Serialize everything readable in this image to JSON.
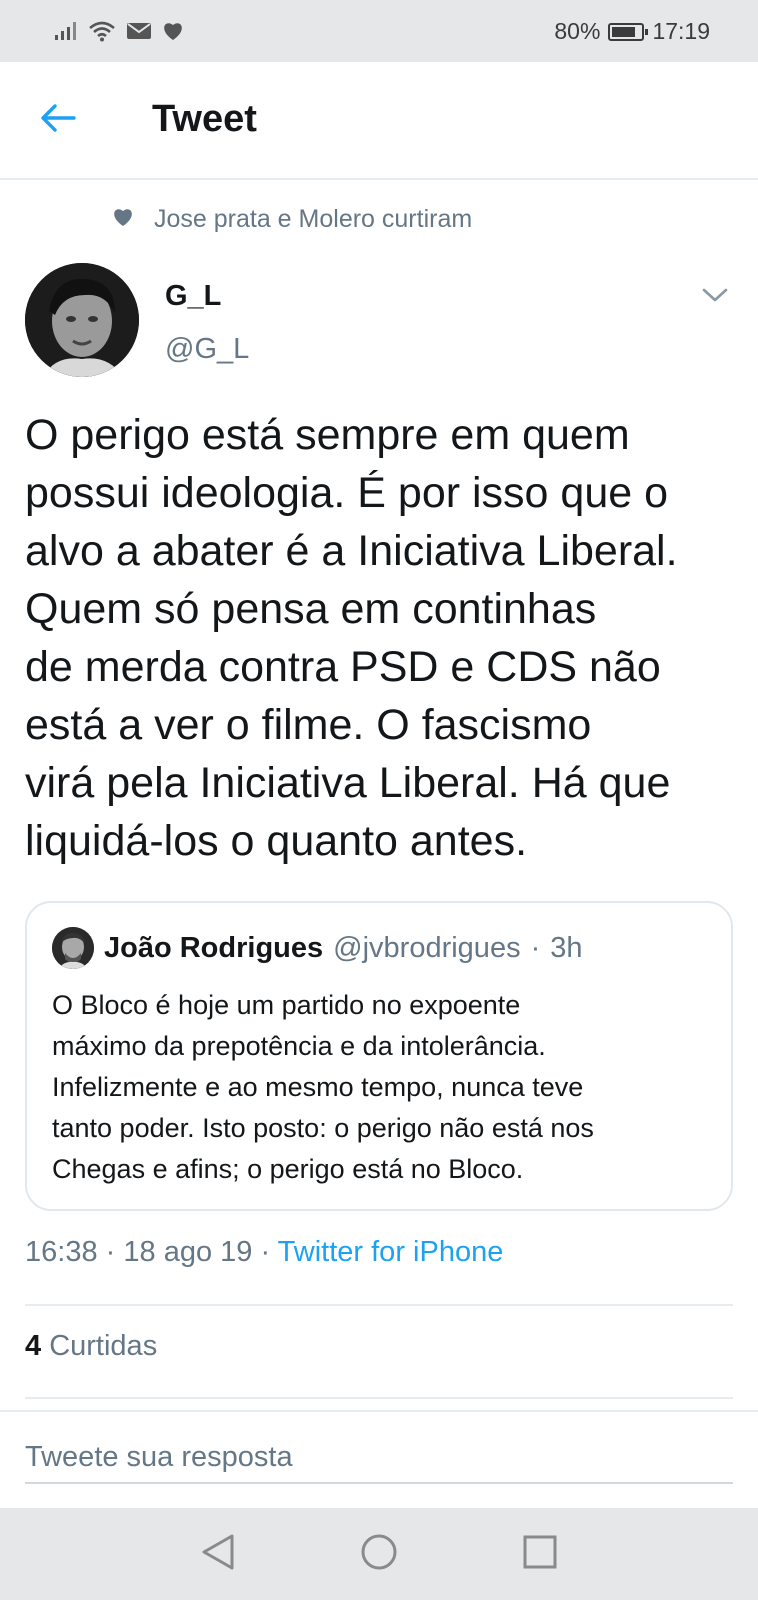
{
  "status_bar": {
    "battery_text": "80%",
    "battery_level": 0.8,
    "time": "17:19"
  },
  "header": {
    "title": "Tweet"
  },
  "social_context": {
    "text": "Jose prata e Molero curtiram"
  },
  "author": {
    "display_name": "G_L",
    "username": "@G_L"
  },
  "tweet": {
    "text": "O perigo está sempre em quem\npossui ideologia. É por isso que o\nalvo a abater é a Iniciativa Liberal.\nQuem só pensa em continhas\nde merda contra PSD e CDS não\nestá a ver o filme. O fascismo\nvirá pela Iniciativa Liberal. Há que\nliquidá-los o quanto antes.",
    "time": "16:38",
    "date": "18 ago 19",
    "separator": "·",
    "source": "Twitter for iPhone"
  },
  "quoted_tweet": {
    "display_name": "João Rodrigues",
    "username": "@jvbrodrigues",
    "separator": "·",
    "age": "3h",
    "text": "O Bloco é hoje um partido no expoente\nmáximo da prepotência e da intolerância.\nInfelizmente e ao mesmo tempo, nunca teve\ntanto poder. Isto posto: o perigo não está nos\nChegas e afins; o perigo está no Bloco."
  },
  "stats": {
    "likes_count": "4",
    "likes_label": "Curtidas"
  },
  "reply": {
    "placeholder": "Tweete sua resposta"
  },
  "colors": {
    "accent": "#1da1f2",
    "secondary_text": "#657786"
  },
  "icons": {
    "back": "arrow-left-icon",
    "heart": "heart-icon",
    "caret": "chevron-down-icon",
    "nav_back": "triangle-back-icon",
    "nav_home": "circle-home-icon",
    "nav_recents": "square-recents-icon"
  }
}
